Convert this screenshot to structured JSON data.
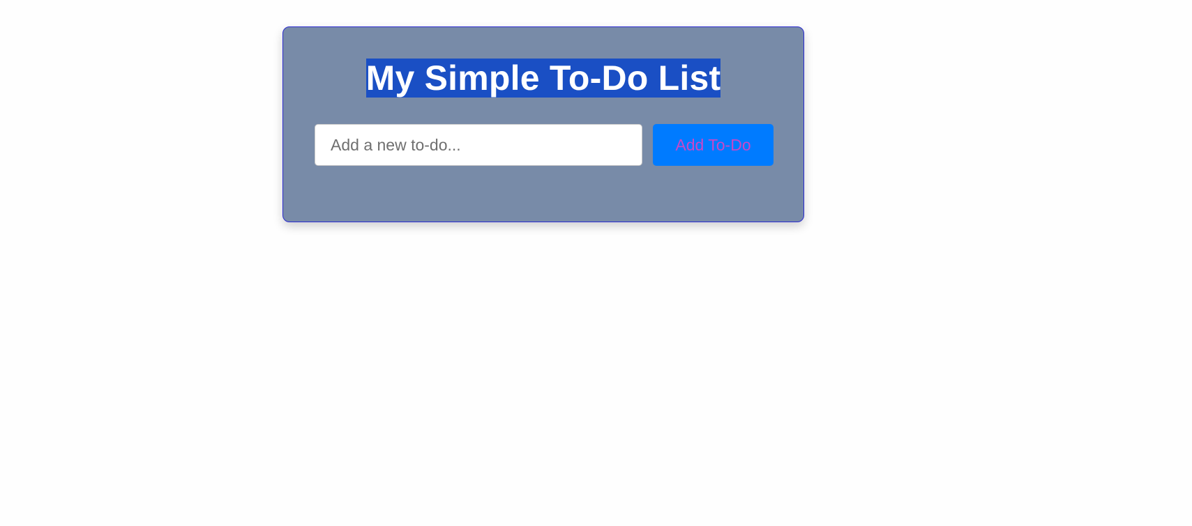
{
  "todo_app": {
    "title": "My Simple To-Do List",
    "input": {
      "placeholder": "Add a new to-do...",
      "value": ""
    },
    "add_button_label": "Add To-Do"
  },
  "colors": {
    "card_background": "#788ba8",
    "card_border": "#2b2bd0",
    "title_highlight": "#1a4fc4",
    "button_background": "#007bff",
    "button_text": "#c948c8"
  }
}
